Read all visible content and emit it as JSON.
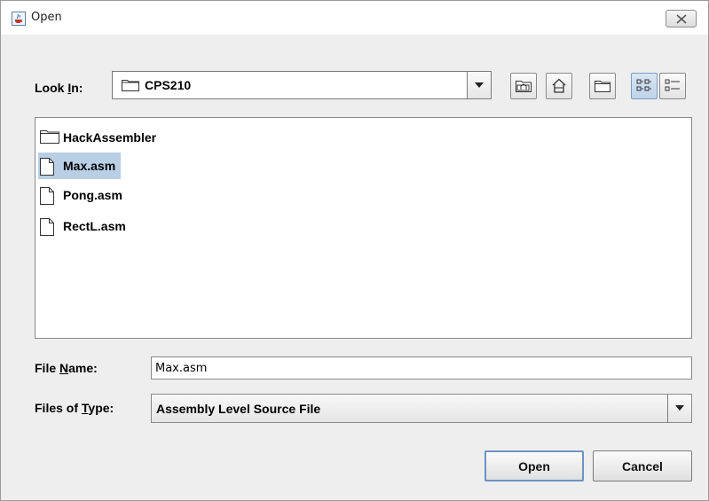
{
  "window": {
    "title": "Open",
    "close_glyph": "✕",
    "app_icon": "java-cup-icon"
  },
  "lookin": {
    "label_prefix": "Look ",
    "label_mnemonic": "I",
    "label_suffix": "n:",
    "value": "CPS210",
    "icon": "folder-icon"
  },
  "toolbar": {
    "buttons": [
      {
        "name": "up-one-level",
        "icon": "folder-up-icon"
      },
      {
        "name": "home",
        "icon": "home-icon"
      },
      {
        "name": "create-new-folder",
        "icon": "new-folder-icon"
      },
      {
        "name": "list-view",
        "icon": "list-view-icon",
        "active": true
      },
      {
        "name": "details-view",
        "icon": "details-view-icon"
      }
    ]
  },
  "files": [
    {
      "name": "HackAssembler",
      "type": "folder",
      "selected": false
    },
    {
      "name": "Max.asm",
      "type": "file",
      "selected": true
    },
    {
      "name": "Pong.asm",
      "type": "file",
      "selected": false
    },
    {
      "name": "RectL.asm",
      "type": "file",
      "selected": false
    }
  ],
  "filename": {
    "label_prefix": "File ",
    "label_mnemonic": "N",
    "label_suffix": "ame:",
    "value": "Max.asm"
  },
  "filetype": {
    "label_prefix": "Files of ",
    "label_mnemonic": "T",
    "label_suffix": "ype:",
    "value": "Assembly Level Source File"
  },
  "buttons": {
    "open": "Open",
    "cancel": "Cancel"
  },
  "colors": {
    "selection": "#b8cfe5",
    "window_bg": "#eeeeee",
    "default_button_border": "#6d93c2"
  }
}
